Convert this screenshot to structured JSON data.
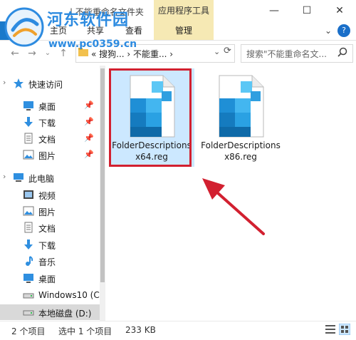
{
  "window": {
    "title": "| 不能重命名文件夹",
    "context_tab_header": "应用程序工具",
    "minimize": "—",
    "maximize": "☐",
    "close": "✕"
  },
  "ribbon": {
    "tabs": [
      {
        "label": "主页"
      },
      {
        "label": "共享"
      },
      {
        "label": "查看"
      }
    ],
    "manage_tab": "管理"
  },
  "address": {
    "path_text": "«  搜狗...  ›  不能重...  ›",
    "search_placeholder": "搜索\"不能重命名文..."
  },
  "sidebar": {
    "items": [
      {
        "label": "快速访问",
        "icon": "star-icon",
        "top": true
      },
      {
        "label": "桌面",
        "icon": "desktop-icon",
        "pinned": true
      },
      {
        "label": "下载",
        "icon": "download-icon",
        "pinned": true
      },
      {
        "label": "文档",
        "icon": "document-icon",
        "pinned": true
      },
      {
        "label": "图片",
        "icon": "picture-icon",
        "pinned": true
      },
      {
        "label": "此电脑",
        "icon": "computer-icon",
        "top": true
      },
      {
        "label": "视频",
        "icon": "video-icon"
      },
      {
        "label": "图片",
        "icon": "picture-icon"
      },
      {
        "label": "文档",
        "icon": "document-icon"
      },
      {
        "label": "下载",
        "icon": "download-icon"
      },
      {
        "label": "音乐",
        "icon": "music-icon"
      },
      {
        "label": "桌面",
        "icon": "desktop-icon"
      },
      {
        "label": "Windows10 (C",
        "icon": "drive-icon"
      },
      {
        "label": "本地磁盘 (D:)",
        "icon": "drive-icon",
        "selected": true
      }
    ]
  },
  "files": [
    {
      "name": "FolderDescriptions x64.reg",
      "selected": true
    },
    {
      "name": "FolderDescriptions x86.reg",
      "selected": false
    }
  ],
  "status": {
    "count": "2 个项目",
    "selected": "选中 1 个项目",
    "size": "233 KB"
  },
  "watermark": {
    "title": "河东软件园",
    "url": "www.pc0359.cn"
  },
  "colors": {
    "accent": "#1979ca",
    "highlight": "#d22030",
    "context_tab": "#f6e9b4"
  }
}
